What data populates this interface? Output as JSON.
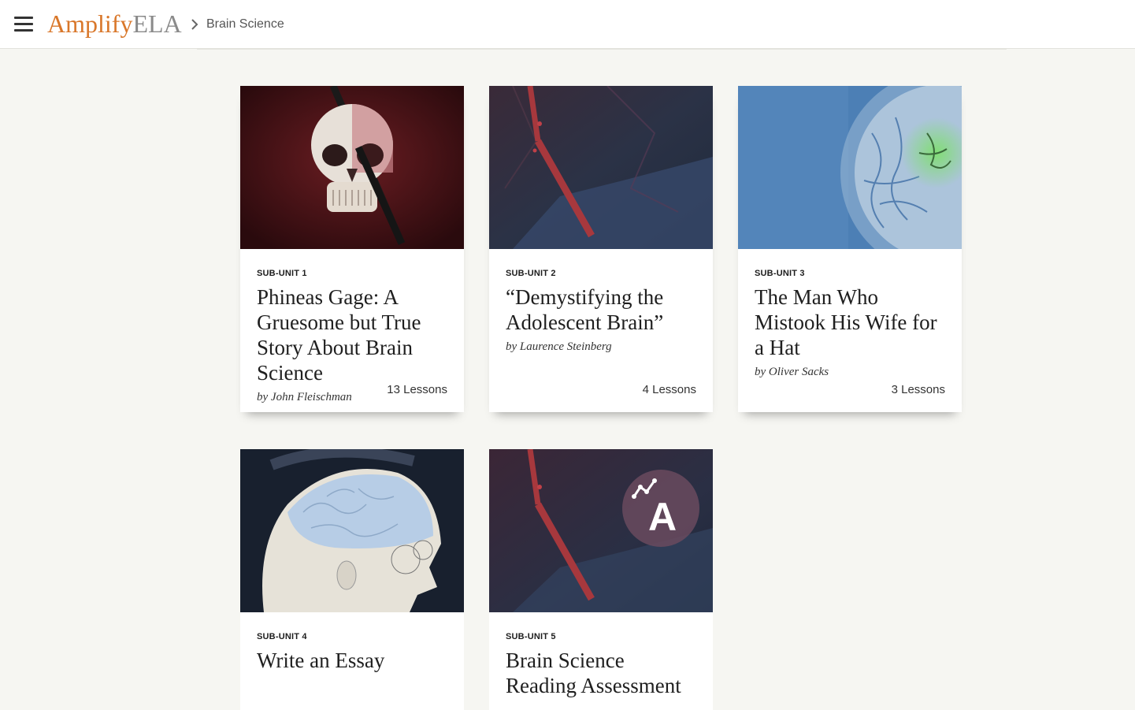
{
  "header": {
    "logo_primary": "Amplify",
    "logo_secondary": "ELA",
    "breadcrumb": "Brain Science",
    "colors": {
      "brand": "#d9772a",
      "logo_gray": "#8a8a8a"
    }
  },
  "cards": [
    {
      "label": "SUB-UNIT 1",
      "title": "Phineas Gage: A Gruesome but True Story About Brain Science",
      "author": "by John Fleischman",
      "lessons": "13 Lessons",
      "image": "skull-with-iron-rod"
    },
    {
      "label": "SUB-UNIT 2",
      "title": "“Demystifying the Adolescent Brain”",
      "author": "by Laurence Steinberg",
      "lessons": "4 Lessons",
      "image": "red-rod-dark-background"
    },
    {
      "label": "SUB-UNIT 3",
      "title": "The Man Who Mistook His Wife for a Hat",
      "author": "by Oliver Sacks",
      "lessons": "3 Lessons",
      "image": "brain-scan-blue"
    },
    {
      "label": "SUB-UNIT 4",
      "title": "Write an Essay",
      "image": "phrenology-head"
    },
    {
      "label": "SUB-UNIT 5",
      "title": "Brain Science Reading Assessment",
      "image": "assessment-badge",
      "badge_letter": "A"
    }
  ]
}
